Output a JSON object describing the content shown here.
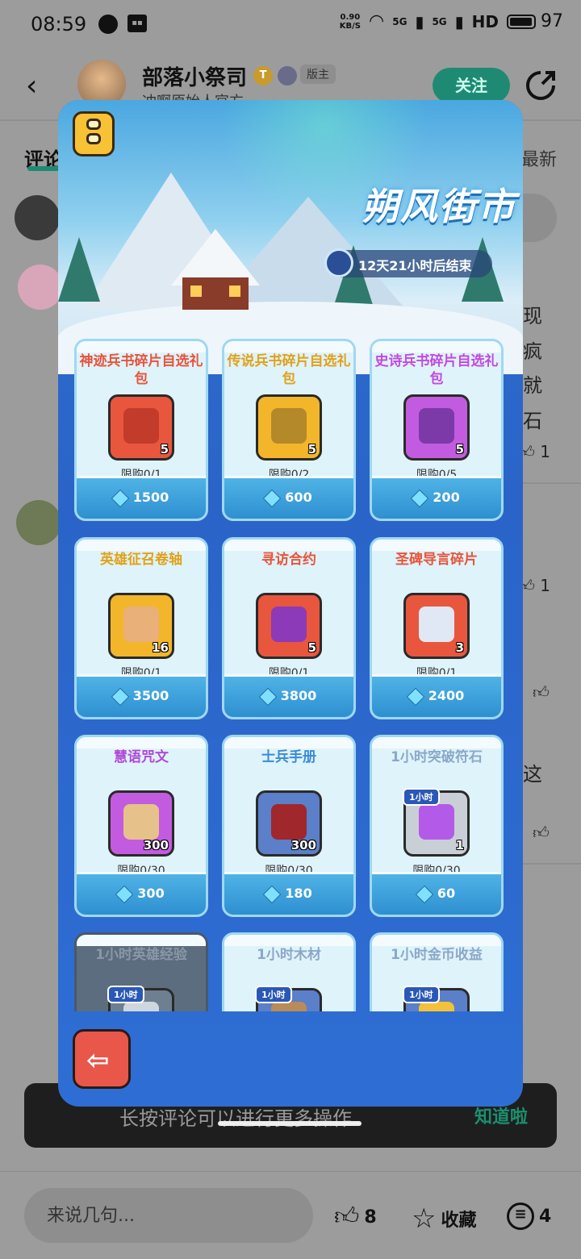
{
  "status": {
    "time": "08:59",
    "net_speed_value": "0.90",
    "net_speed_unit": "KB/S",
    "signal1": "5G",
    "signal2": "5G",
    "hd": "HD",
    "battery": "97",
    "battery_level": 0.97
  },
  "header": {
    "username": "部落小祭司",
    "subtitle": "冲啊原始人官方",
    "badge_t": "T",
    "badge_mod": "版主",
    "follow": "关注"
  },
  "background": {
    "tab_left": "评论",
    "tab_right": "最新",
    "text_lines": [
      "现",
      "疯",
      "就",
      "石"
    ],
    "like1": "1",
    "like2": "1",
    "text_line_5": "这"
  },
  "overlay": {
    "event_title": "朔风街市",
    "timer": "12天21小时后结束",
    "items": [
      {
        "name": "神迹兵书碎片自选礼包",
        "count": "5",
        "limit": "限购0/1",
        "price": "1500",
        "name_color": "#e8543a",
        "icon_bg": "#e9563e",
        "inner": "#c33b2a"
      },
      {
        "name": "传说兵书碎片自选礼包",
        "count": "5",
        "limit": "限购0/2",
        "price": "600",
        "name_color": "#e0a21a",
        "icon_bg": "#f3b62a",
        "inner": "#b4892a"
      },
      {
        "name": "史诗兵书碎片自选礼包",
        "count": "5",
        "limit": "限购0/5",
        "price": "200",
        "name_color": "#c24ae0",
        "icon_bg": "#c35be0",
        "inner": "#7c3aa8"
      },
      {
        "name": "英雄征召卷轴",
        "count": "16",
        "limit": "限购0/1",
        "price": "3500",
        "name_color": "#e0a21a",
        "icon_bg": "#f3b62a",
        "inner": "#e9b07a"
      },
      {
        "name": "寻访合约",
        "count": "5",
        "limit": "限购0/1",
        "price": "3800",
        "name_color": "#e8543a",
        "icon_bg": "#e9563e",
        "inner": "#8c3ab8"
      },
      {
        "name": "圣碑导言碎片",
        "count": "3",
        "limit": "限购0/1",
        "price": "2400",
        "name_color": "#e8543a",
        "icon_bg": "#e9563e",
        "inner": "#dfe8f4"
      },
      {
        "name": "慧语咒文",
        "count": "300",
        "limit": "限购0/30",
        "price": "300",
        "name_color": "#b04ad8",
        "icon_bg": "#c35be0",
        "inner": "#e6c28a"
      },
      {
        "name": "士兵手册",
        "count": "300",
        "limit": "限购0/30",
        "price": "180",
        "name_color": "#3a8ad8",
        "icon_bg": "#5b7fc8",
        "inner": "#a0272b"
      },
      {
        "name": "1小时突破符石",
        "count": "1",
        "limit": "限购0/30",
        "price": "60",
        "name_color": "#8aa8c8",
        "icon_bg": "#c9cfd6",
        "inner": "#b35ae8",
        "tag": "1小时"
      },
      {
        "name": "1小时英雄经验",
        "count": "",
        "limit": "",
        "price": "",
        "name_color": "#8a97a5",
        "icon_bg": "#6e7f92",
        "inner": "#cfd6de",
        "tag": "1小时",
        "dim": true
      },
      {
        "name": "1小时木材",
        "count": "",
        "limit": "",
        "price": "",
        "name_color": "#8aa8c8",
        "icon_bg": "#5b7fc8",
        "inner": "#b98a5a",
        "tag": "1小时"
      },
      {
        "name": "1小时金币收益",
        "count": "",
        "limit": "",
        "price": "",
        "name_color": "#8aa8c8",
        "icon_bg": "#5b7fc8",
        "inner": "#f3c23a",
        "tag": "1小时"
      }
    ]
  },
  "toast": {
    "text": "长按评论可以进行更多操作",
    "button": "知道啦"
  },
  "bottom": {
    "placeholder": "来说几句...",
    "likes": "8",
    "favorite": "收藏",
    "comments": "4"
  },
  "icons": {
    "back": "chevron-left-icon",
    "share": "share-icon",
    "like": "thumbs-up-icon",
    "star": "star-icon",
    "comment": "comment-icon",
    "gem": "gem-icon",
    "clock": "clock-icon",
    "menu": "menu-icon",
    "return": "arrow-left-icon"
  }
}
